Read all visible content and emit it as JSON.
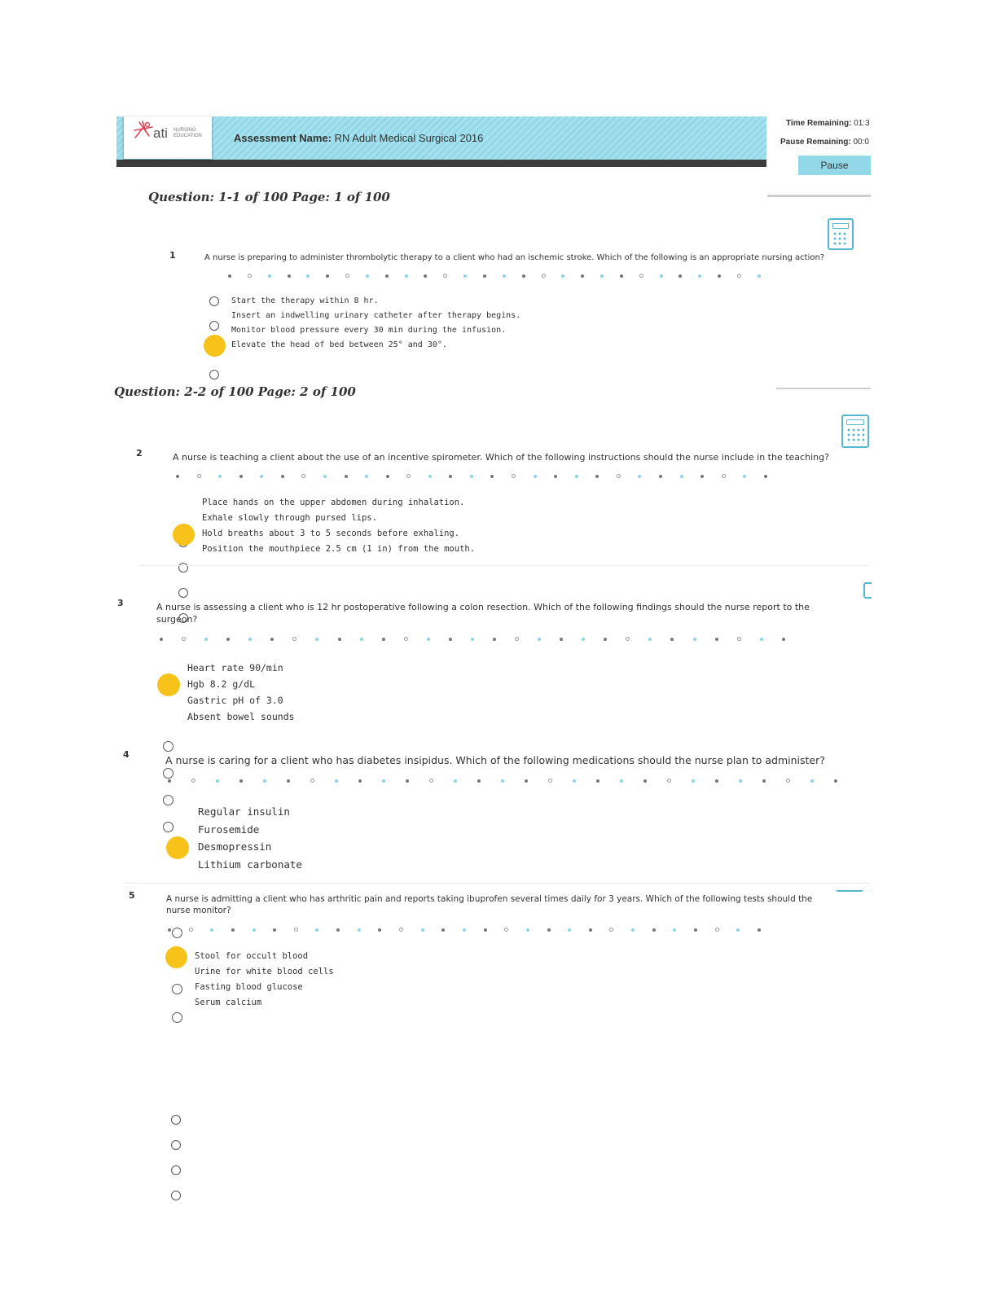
{
  "header": {
    "assessment_label": "Assessment Name:",
    "assessment_name": "RN Adult Medical Surgical 2016",
    "logo_text": "ati",
    "logo_sub": "NURSING EDUCATION",
    "time_label": "Time Remaining:",
    "time_value": "01:3",
    "pause_label": "Pause Remaining:",
    "pause_value": "00:0",
    "pause_button": "Pause"
  },
  "headings": [
    "Question: 1-1  of 100  Page: 1  of 100",
    "Question: 2-2  of 100  Page: 2  of 100"
  ],
  "questions": [
    {
      "number": "1",
      "text": "A nurse is preparing to administer thrombolytic therapy to a client who had an ischemic stroke. Which of the following is an appropriate nursing action?",
      "options": [
        "Start the therapy within 8 hr.",
        "Insert an indwelling urinary catheter after therapy begins.",
        "Monitor blood pressure every 30 min during the infusion.",
        "Elevate the head of bed between 25° and 30°."
      ],
      "selected": 3
    },
    {
      "number": "2",
      "text": "A nurse is teaching a client about the use of an incentive spirometer. Which of the following instructions should the nurse include in the teaching?",
      "options": [
        "Place hands on the upper abdomen during inhalation.",
        "Exhale slowly through pursed lips.",
        "Hold breaths about 3 to 5 seconds before exhaling.",
        "Position the mouthpiece 2.5 cm (1 in) from the mouth."
      ],
      "selected": 2
    },
    {
      "number": "3",
      "text_line1": "A nurse is assessing a client who is 12 hr postoperative following a colon resection. Which of the following findings should the nurse report to the",
      "text_line2": "surgeon?",
      "options": [
        "Heart rate 90/min",
        "Hgb 8.2 g/dL",
        "Gastric pH of 3.0",
        "Absent bowel sounds"
      ],
      "selected": 1
    },
    {
      "number": "4",
      "text": "A nurse is caring for a client who has diabetes insipidus. Which of the following medications should the nurse plan to administer?",
      "options": [
        "Regular insulin",
        "Furosemide",
        "Desmopressin",
        "Lithium carbonate"
      ],
      "selected": 2
    },
    {
      "number": "5",
      "text_line1": "A nurse is admitting a client who has arthritic pain and reports taking ibuprofen several times daily for 3 years. Which of the following tests should the",
      "text_line2": "nurse monitor?",
      "options": [
        "Stool for occult blood",
        "Urine for white blood cells",
        "Fasting blood glucose",
        "Serum calcium"
      ],
      "selected": 0
    }
  ],
  "colors": {
    "accent": "#93d8e8",
    "highlight": "#f7c21a",
    "calculator": "#56b7cf"
  },
  "icons": [
    "ati-logo-icon",
    "calculator-icon"
  ]
}
